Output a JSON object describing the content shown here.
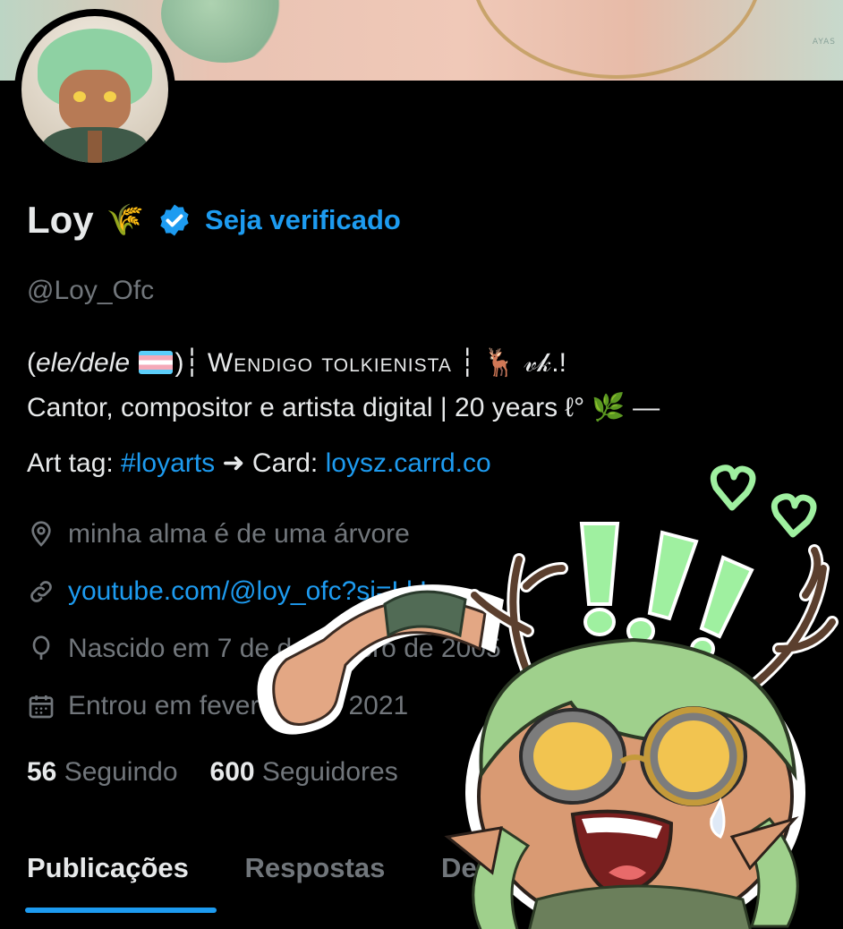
{
  "profile": {
    "name": "Loy",
    "name_emoji": "🌾",
    "verify_label": "Seja verificado",
    "handle": "@Loy_Ofc"
  },
  "bio": {
    "line1_pronouns": "ele/dele",
    "line1_sep": "┆",
    "line1_title": "Wendigo tolkienista",
    "line1_tail": "┆ 🦌 𝓋𝓀.!",
    "line2": "Cantor, compositor e artista digital | 20 years ℓ° 🌿 —",
    "line3_prefix": "Art tag: ",
    "line3_hashtag": "#loyarts",
    "line3_mid": " ➜ Card: ",
    "line3_link": "loysz.carrd.co"
  },
  "meta": {
    "location": "minha alma é de uma árvore",
    "website": "youtube.com/@loy_ofc?si=LkL...",
    "birthday": "Nascido em 7 de dezembro de 2005",
    "joined": "Entrou em fevereiro de 2021"
  },
  "counts": {
    "following_value": "56",
    "following_label": "Seguindo",
    "followers_value": "600",
    "followers_label": "Seguidores"
  },
  "tabs": [
    "Publicações",
    "Respostas",
    "Destaques"
  ],
  "colors": {
    "accent": "#1d9bf0",
    "muted": "#71767b",
    "sticker_green": "#9ff0a0"
  },
  "icons": [
    "location-icon",
    "link-icon",
    "balloon-icon",
    "calendar-icon",
    "verified-badge-icon"
  ]
}
